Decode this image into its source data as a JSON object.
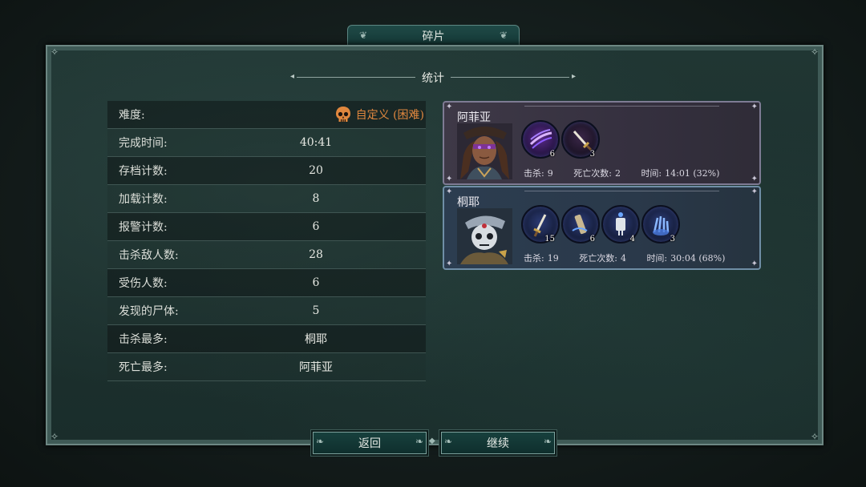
{
  "window": {
    "title": "碎片"
  },
  "section": {
    "title": "统计"
  },
  "stats": {
    "difficulty_label": "难度:",
    "difficulty_value": "自定义 (困难)",
    "rows": [
      {
        "label": "完成时间:",
        "value": "40:41"
      },
      {
        "label": "存档计数:",
        "value": "20"
      },
      {
        "label": "加载计数:",
        "value": "8"
      },
      {
        "label": "报警计数:",
        "value": "6"
      },
      {
        "label": "击杀敌人数:",
        "value": "28"
      },
      {
        "label": "受伤人数:",
        "value": "6"
      },
      {
        "label": "发现的尸体:",
        "value": "5"
      },
      {
        "label": "击杀最多:",
        "value": "桐耶"
      },
      {
        "label": "死亡最多:",
        "value": "阿菲亚"
      }
    ]
  },
  "characters": [
    {
      "name": "阿菲亚",
      "skills": [
        {
          "icon": "claw-strike-icon",
          "count": "6"
        },
        {
          "icon": "dagger-icon",
          "count": "3"
        }
      ],
      "kills_label": "击杀:",
      "kills": "9",
      "deaths_label": "死亡次数:",
      "deaths": "2",
      "time_label": "时间:",
      "time": "14:01 (32%)"
    },
    {
      "name": "桐耶",
      "skills": [
        {
          "icon": "sword-icon",
          "count": "15"
        },
        {
          "icon": "flask-icon",
          "count": "6"
        },
        {
          "icon": "crossbow-icon",
          "count": "4"
        },
        {
          "icon": "ghost-hand-icon",
          "count": "3"
        }
      ],
      "kills_label": "击杀:",
      "kills": "19",
      "deaths_label": "死亡次数:",
      "deaths": "4",
      "time_label": "时间:",
      "time": "30:04 (68%)"
    }
  ],
  "buttons": {
    "back": "返回",
    "continue": "继续"
  },
  "colors": {
    "difficulty": "#e0873e",
    "accent": "#7ea29d"
  }
}
